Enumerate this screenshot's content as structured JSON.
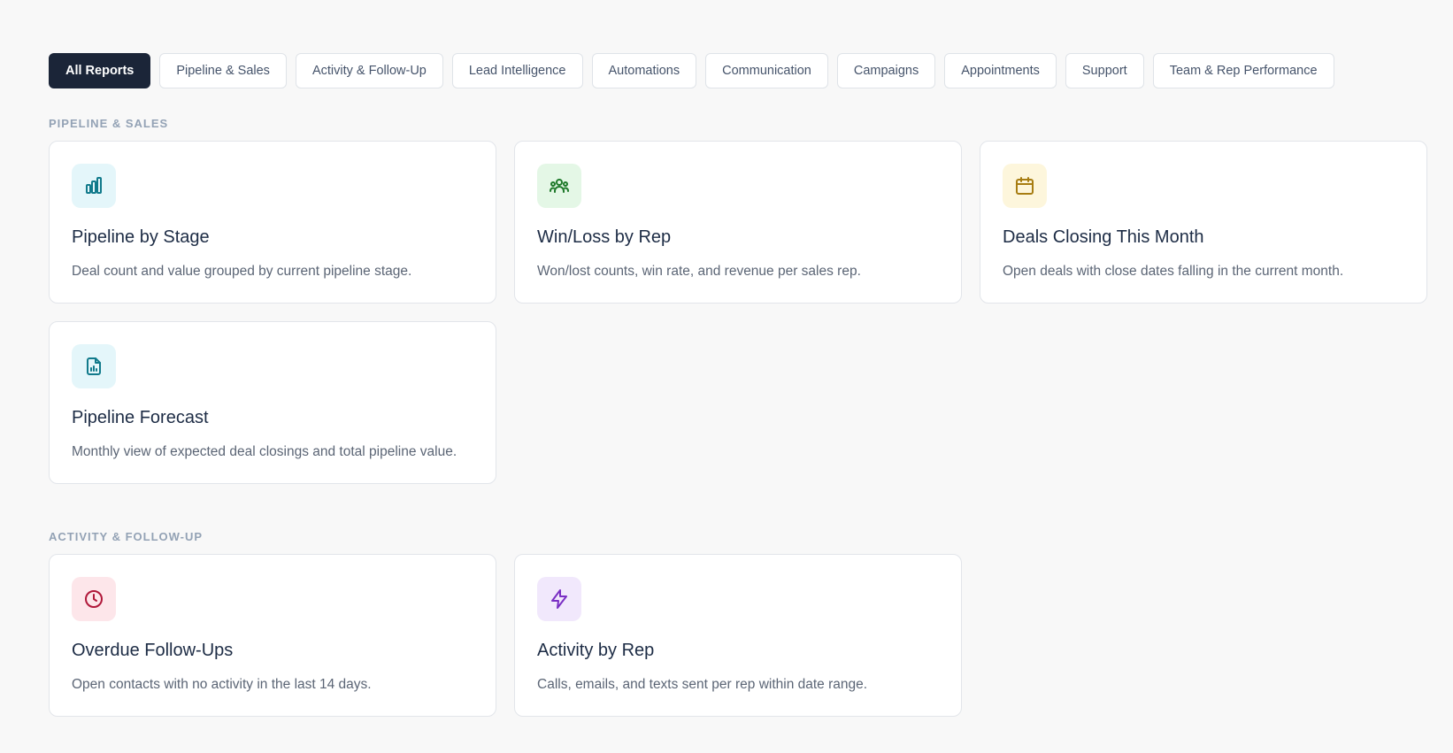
{
  "tabs": [
    {
      "label": "All Reports",
      "active": true
    },
    {
      "label": "Pipeline & Sales"
    },
    {
      "label": "Activity & Follow-Up"
    },
    {
      "label": "Lead Intelligence"
    },
    {
      "label": "Automations"
    },
    {
      "label": "Communication"
    },
    {
      "label": "Campaigns"
    },
    {
      "label": "Appointments"
    },
    {
      "label": "Support"
    },
    {
      "label": "Team & Rep Performance"
    }
  ],
  "sections": [
    {
      "title": "Pipeline & Sales",
      "cards": [
        {
          "title": "Pipeline by Stage",
          "description": "Deal count and value grouped by current pipeline stage.",
          "icon": "bar-chart-icon",
          "icon_bg": "#e4f6fa",
          "icon_color": "#117a8b"
        },
        {
          "title": "Win/Loss by Rep",
          "description": "Won/lost counts, win rate, and revenue per sales rep.",
          "icon": "users-icon",
          "icon_bg": "#e4f7e6",
          "icon_color": "#1f7a2b"
        },
        {
          "title": "Deals Closing This Month",
          "description": "Open deals with close dates falling in the current month.",
          "icon": "calendar-icon",
          "icon_bg": "#fdf6dc",
          "icon_color": "#a77d12"
        },
        {
          "title": "Pipeline Forecast",
          "description": "Monthly view of expected deal closings and total pipeline value.",
          "icon": "report-file-icon",
          "icon_bg": "#e4f6fa",
          "icon_color": "#117a8b"
        }
      ]
    },
    {
      "title": "Activity & Follow-Up",
      "cards": [
        {
          "title": "Overdue Follow-Ups",
          "description": "Open contacts with no activity in the last 14 days.",
          "icon": "clock-icon",
          "icon_bg": "#fde6ea",
          "icon_color": "#b0183a"
        },
        {
          "title": "Activity by Rep",
          "description": "Calls, emails, and texts sent per rep within date range.",
          "icon": "lightning-icon",
          "icon_bg": "#f1e8fc",
          "icon_color": "#7a2fc4"
        }
      ]
    }
  ]
}
